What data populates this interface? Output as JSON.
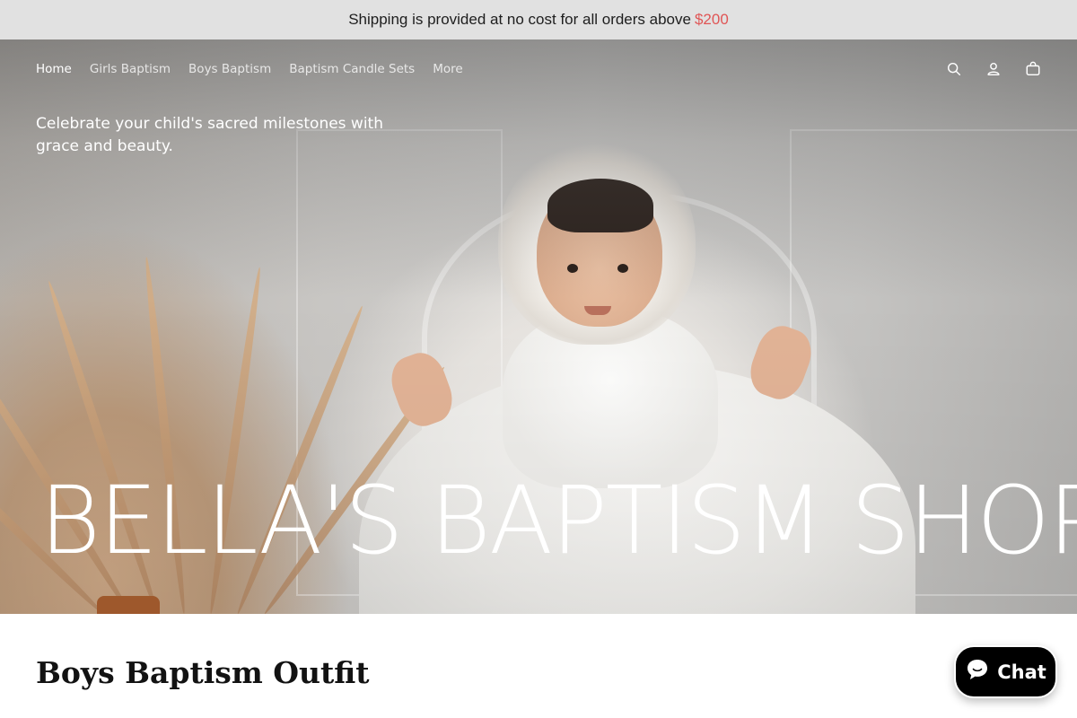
{
  "announcement": {
    "text": "Shipping is provided at no cost for all orders above",
    "price": "$200"
  },
  "nav": {
    "links": [
      {
        "label": "Home",
        "active": true
      },
      {
        "label": "Girls Baptism",
        "active": false
      },
      {
        "label": "Boys Baptism",
        "active": false
      },
      {
        "label": "Baptism Candle Sets",
        "active": false
      },
      {
        "label": "More",
        "active": false
      }
    ],
    "icons": [
      "search-icon",
      "account-icon",
      "cart-icon"
    ]
  },
  "hero": {
    "tagline": "Celebrate your child's sacred milestones with grace and beauty.",
    "title": "BELLA'S BAPTISM SHOP"
  },
  "section": {
    "title": "Boys Baptism Outfit"
  },
  "chat": {
    "label": "Chat"
  },
  "colors": {
    "announcement_bg": "#e1e1e1",
    "price_accent": "#e05555",
    "chat_bg": "#000000"
  }
}
